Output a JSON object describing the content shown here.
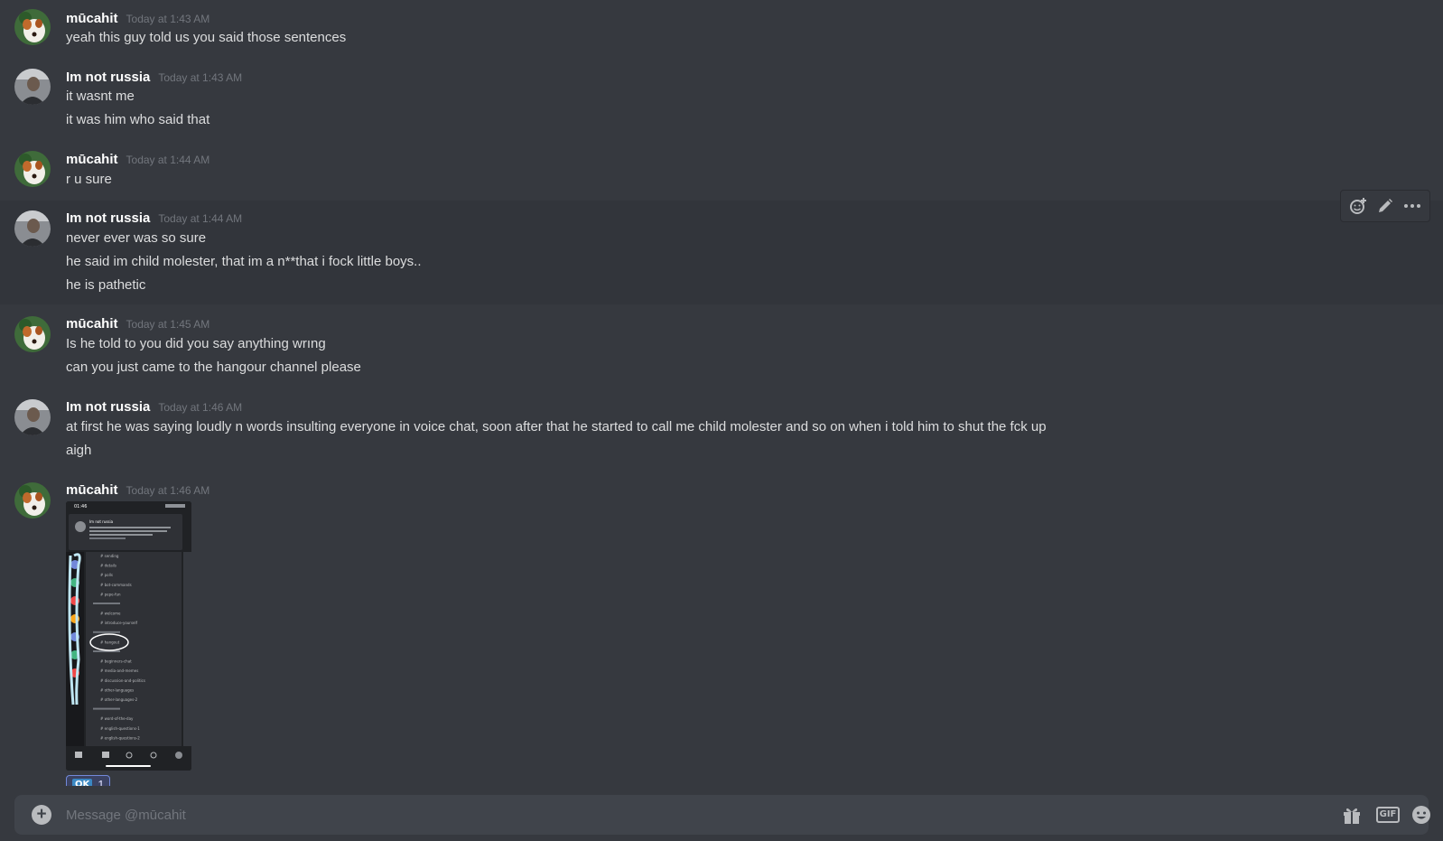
{
  "colors": {
    "background": "#36393f",
    "composer": "#40444b",
    "username": "#ffffff",
    "timestamp": "#72767d",
    "text": "#dcddde",
    "reaction_border": "#7289da"
  },
  "messages": [
    {
      "author": "mūcahit",
      "time": "Today at 1:43 AM",
      "lines": [
        "yeah this guy told us you said those sentences"
      ]
    },
    {
      "author": "Im not russia",
      "time": "Today at 1:43 AM",
      "lines": [
        "it wasnt me",
        "it was him who said that"
      ]
    },
    {
      "author": "mūcahit",
      "time": "Today at 1:44 AM",
      "lines": [
        "r u sure"
      ]
    },
    {
      "author": "Im not russia",
      "time": "Today at 1:44 AM",
      "lines": [
        "never ever was so sure",
        "he said im child molester, that im a n**that i fock little boys..",
        "he is pathetic"
      ]
    },
    {
      "author": "mūcahit",
      "time": "Today at 1:45 AM",
      "lines": [
        "Is he told to you did you say anything wrıng",
        "can you just came to the hangour channel please"
      ]
    },
    {
      "author": "Im not russia",
      "time": "Today at 1:46 AM",
      "lines": [
        "at first he was saying loudly n words insulting everyone in voice chat, soon after that he started to call me child molester and so on when i told him to shut the fck up",
        "aigh"
      ]
    },
    {
      "author": "mūcahit",
      "time": "Today at 1:46 AM",
      "lines": []
    }
  ],
  "message_actions": {
    "icons": [
      "add-reaction-icon",
      "edit-icon",
      "more-icon"
    ]
  },
  "attachment": {
    "status_time": "01:46",
    "header_name": "Im not russia",
    "channels": [
      "sending",
      "details",
      "polls",
      "bot-commands",
      "pepe-fun",
      "",
      "welcome",
      "introduce-yourself",
      "",
      "hangout",
      "",
      "beginners-chat",
      "media-and-memes",
      "discussion-and-politics",
      "other-languages",
      "other-languages-2",
      "",
      "word-of-the-day",
      "english-questions-1",
      "english-questions-2"
    ]
  },
  "reaction": {
    "emoji": "OK",
    "count": "1"
  },
  "composer": {
    "placeholder": "Message @mūcahit",
    "icons": [
      "gift-icon",
      "gif-icon",
      "emoji-icon"
    ],
    "gif_label": "GIF"
  }
}
